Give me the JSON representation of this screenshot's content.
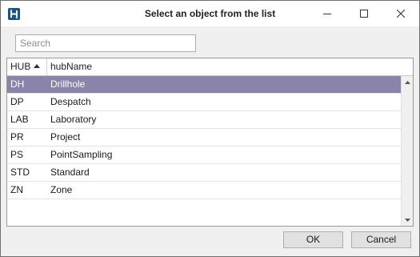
{
  "window": {
    "title": "Select an object from the list",
    "icon": "app-logo-icon",
    "controls": [
      "minimize-icon",
      "maximize-icon",
      "close-icon"
    ]
  },
  "search": {
    "placeholder": "Search",
    "value": ""
  },
  "grid": {
    "columns": [
      {
        "label": "HUB",
        "sort": "ascending"
      },
      {
        "label": "hubName"
      }
    ],
    "rows": [
      {
        "hub": "DH",
        "name": "Drillhole",
        "selected": true
      },
      {
        "hub": "DP",
        "name": "Despatch"
      },
      {
        "hub": "LAB",
        "name": "Laboratory"
      },
      {
        "hub": "PR",
        "name": "Project"
      },
      {
        "hub": "PS",
        "name": "PointSampling"
      },
      {
        "hub": "STD",
        "name": "Standard"
      },
      {
        "hub": "ZN",
        "name": "Zone"
      }
    ]
  },
  "buttons": {
    "ok": "OK",
    "cancel": "Cancel"
  },
  "colors": {
    "selected_row": "#8a84aa",
    "app_icon": "#1f4f7a"
  }
}
